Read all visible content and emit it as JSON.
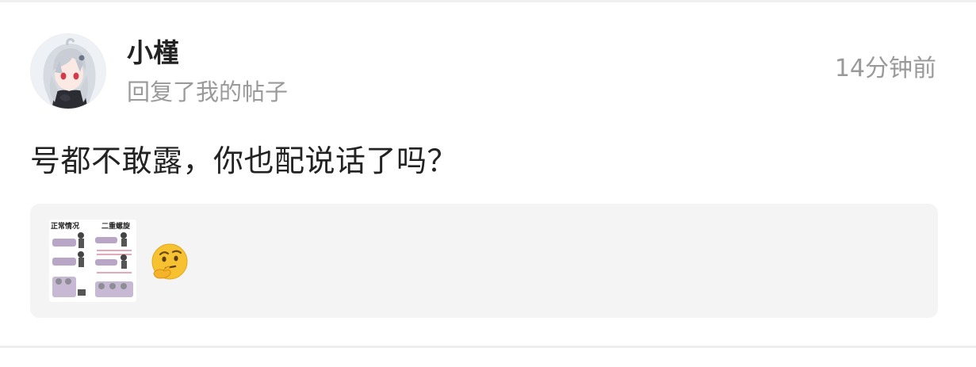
{
  "notification": {
    "user": {
      "name": "小槿",
      "avatar_icon": "anime-avatar-icon"
    },
    "action": "回复了我的帖子",
    "time": "14分钟前",
    "reply": "号都不敢露，你也配说话了吗？",
    "quoted_post": {
      "thumbnail": {
        "label_left": "正常情况",
        "label_right": "二重螺旋"
      },
      "emoji": "thinking-face-icon"
    }
  },
  "colors": {
    "username": "#222222",
    "secondary_text": "#9a9a9a",
    "quote_background": "#f4f4f4",
    "emoji_yellow": "#f7c232"
  }
}
